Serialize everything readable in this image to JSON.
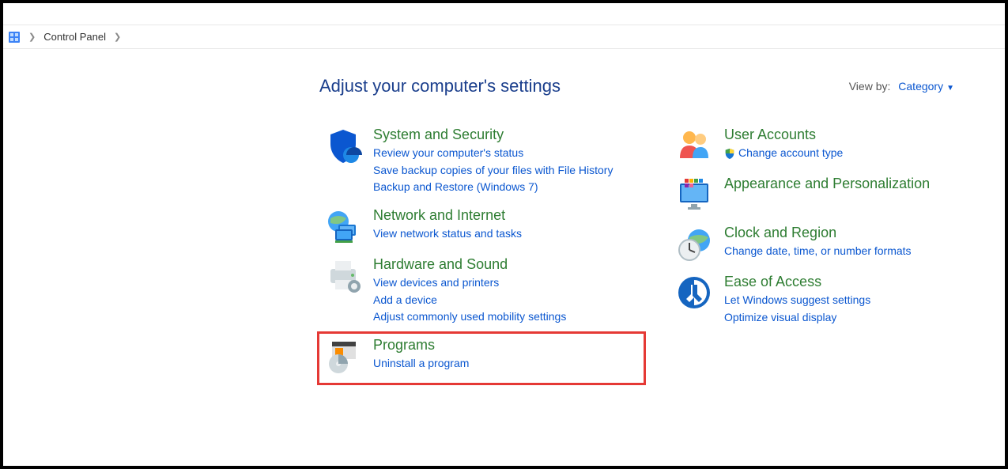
{
  "breadcrumb": {
    "root": "Control Panel"
  },
  "header": {
    "title": "Adjust your computer's settings",
    "view_by_label": "View by:",
    "view_by_value": "Category"
  },
  "left": {
    "system": {
      "title": "System and Security",
      "l1": "Review your computer's status",
      "l2": "Save backup copies of your files with File History",
      "l3": "Backup and Restore (Windows 7)"
    },
    "network": {
      "title": "Network and Internet",
      "l1": "View network status and tasks"
    },
    "hardware": {
      "title": "Hardware and Sound",
      "l1": "View devices and printers",
      "l2": "Add a device",
      "l3": "Adjust commonly used mobility settings"
    },
    "programs": {
      "title": "Programs",
      "l1": "Uninstall a program"
    }
  },
  "right": {
    "users": {
      "title": "User Accounts",
      "l1": "Change account type"
    },
    "appearance": {
      "title": "Appearance and Personalization"
    },
    "clock": {
      "title": "Clock and Region",
      "l1": "Change date, time, or number formats"
    },
    "ease": {
      "title": "Ease of Access",
      "l1": "Let Windows suggest settings",
      "l2": "Optimize visual display"
    }
  }
}
